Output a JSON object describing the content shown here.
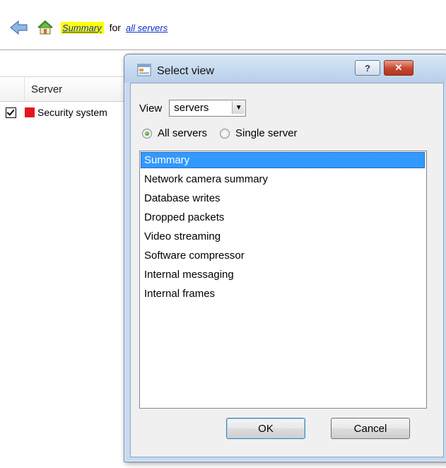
{
  "nav": {
    "summary_link": "Summary",
    "for_text": "for",
    "servers_link": "all servers"
  },
  "background": {
    "column_header": "Server",
    "row_name": "Security system",
    "row_checked": true,
    "row_status_color": "#e8141c"
  },
  "dialog": {
    "title": "Select view",
    "help_label": "?",
    "close_label": "✕",
    "view_label": "View",
    "view_value": "servers",
    "radio_all": "All servers",
    "radio_single": "Single server",
    "selected_radio": "All servers",
    "items": [
      "Summary",
      "Network camera summary",
      "Database writes",
      "Dropped packets",
      "Video streaming",
      "Software compressor",
      "Internal messaging",
      "Internal frames"
    ],
    "selected_item": "Summary",
    "ok_label": "OK",
    "cancel_label": "Cancel"
  },
  "colors": {
    "selection": "#3399ff",
    "highlight": "#ffff00",
    "link": "#0a2fcc"
  }
}
